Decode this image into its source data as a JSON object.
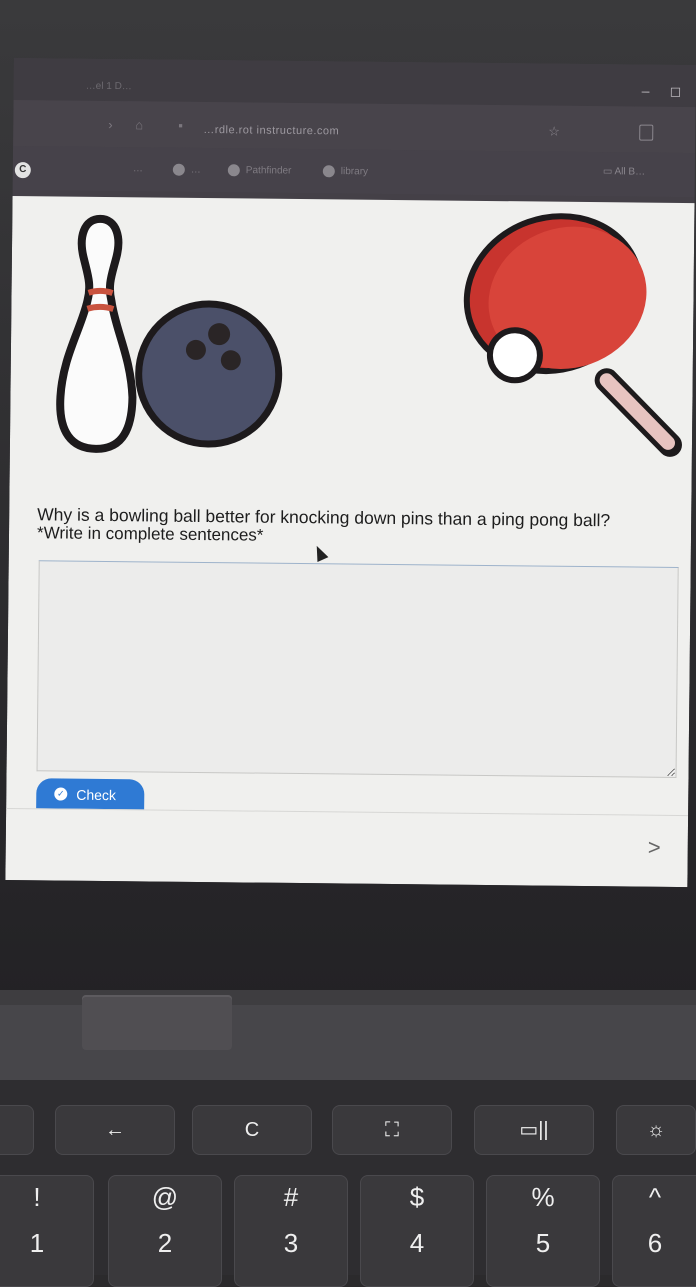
{
  "browser": {
    "tab_title": "…el 1 D…",
    "url": "…rdle.rot instructure.com",
    "bookmarks": [
      {
        "label": "…"
      },
      {
        "label": "…"
      },
      {
        "label": "Pathfinder"
      },
      {
        "label": "library"
      }
    ],
    "folder_bookmark": "All B…"
  },
  "content": {
    "question": "Why is a bowling ball better for knocking down pins than a ping pong ball?",
    "instruction": "*Write in complete sentences*",
    "answer_value": "",
    "check_label": "Check",
    "next_symbol": ">"
  },
  "keyboard": {
    "function_keys": [
      {
        "glyph": "←",
        "name": "back"
      },
      {
        "glyph": "C",
        "name": "refresh"
      },
      {
        "glyph": "⛶",
        "name": "fullscreen"
      },
      {
        "glyph": "▭||",
        "name": "overview"
      },
      {
        "glyph": "☼",
        "name": "brightness"
      }
    ],
    "number_keys": [
      {
        "sym": "!",
        "num": "1"
      },
      {
        "sym": "@",
        "num": "2"
      },
      {
        "sym": "#",
        "num": "3"
      },
      {
        "sym": "$",
        "num": "4"
      },
      {
        "sym": "%",
        "num": "5"
      },
      {
        "sym": "^",
        "num": "6"
      }
    ]
  },
  "colors": {
    "check_button": "#2f7ad4",
    "bowling_ball": "#4b5069",
    "paddle": "#d13b35"
  }
}
